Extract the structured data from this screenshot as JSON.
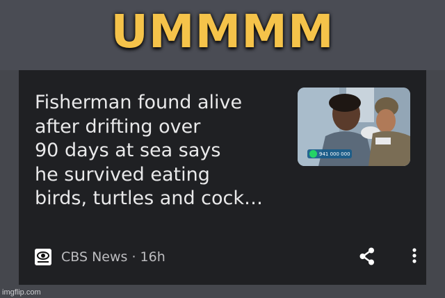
{
  "meme": {
    "caption": "UMMMM",
    "caption_color": "#f5c34a",
    "watermark": "imgflip.com"
  },
  "card": {
    "headline": "Fisherman found alive\nafter drifting over\n90 days at sea says\nhe survived eating\nbirds, turtles and cock…",
    "thumbnail": {
      "overlay_text": "941 000 000",
      "overlay_icon": "whatsapp-icon"
    },
    "source": {
      "logo_icon": "cbs-eye-logo",
      "logo_text": "CBSNEWS",
      "name": "CBS News",
      "separator": "·",
      "age": "16h",
      "line": "CBS News · 16h"
    },
    "actions": {
      "share_icon": "share-icon",
      "more_icon": "more-vert-icon"
    },
    "colors": {
      "card_background": "#1f2023",
      "headline_text": "#e9e9ea",
      "meta_text": "#bdbdc0"
    }
  }
}
